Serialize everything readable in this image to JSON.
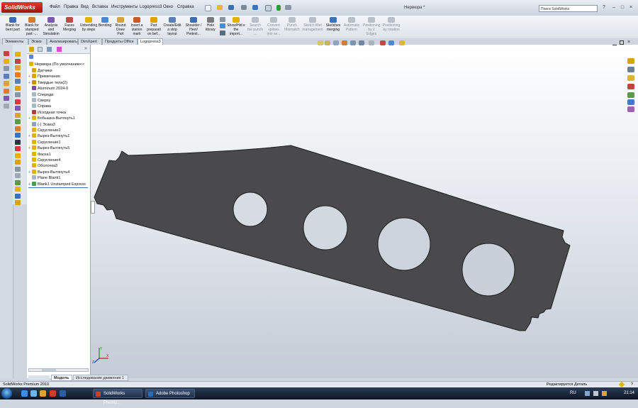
{
  "app": {
    "logo_text": "SolidWorks",
    "doc_title": "Нервюра *",
    "menu": [
      "Файл",
      "Правка",
      "Вид",
      "Вставка",
      "Инструменты",
      "Logopress3",
      "Окно",
      "Справка"
    ],
    "search_placeholder": "Поиск SolidWorks",
    "window_controls": [
      "?",
      "–",
      "□",
      "×"
    ]
  },
  "commands": [
    {
      "label": "Blank for bent part",
      "icon": "blank-icon",
      "enabled": true
    },
    {
      "label": "Blank for stamped part -...",
      "icon": "stamp-icon",
      "enabled": true
    },
    {
      "label": "Analysis and Simulation",
      "icon": "analysis-icon",
      "enabled": true
    },
    {
      "label": "Faces Merging",
      "icon": "merge-icon",
      "enabled": true
    },
    {
      "label": "Unbending by steps",
      "icon": "unbend-icon",
      "enabled": true
    },
    {
      "label": "Bending",
      "icon": "bend-icon",
      "enabled": true
    },
    {
      "label": "Round Draw Part",
      "icon": "draw-icon",
      "enabled": true
    },
    {
      "label": "Insert a station mark",
      "icon": "station-icon",
      "enabled": true
    },
    {
      "label": "Part preparati on bef...",
      "icon": "prep-icon",
      "enabled": true
    },
    {
      "label": "Create/Edit a strip layout",
      "icon": "strip-icon",
      "enabled": true
    },
    {
      "label": "Shoulder / Heel/ Pedest...",
      "icon": "shoulder-icon",
      "enabled": true
    },
    {
      "label": "Hole library",
      "icon": "hole-icon",
      "enabled": true
    },
    {
      "label": "Show/Hid e the import...",
      "icon": "showhide-icon",
      "enabled": true
    },
    {
      "label": "Search the punch ...",
      "icon": "search-punch-icon",
      "enabled": false
    },
    {
      "label": "Convert splines into se...",
      "icon": "convert-icon",
      "enabled": false
    },
    {
      "label": "Punch Mismatch",
      "icon": "mismatch-icon",
      "enabled": false
    },
    {
      "label": "Sketch fillet management",
      "icon": "fillet-icon",
      "enabled": false
    },
    {
      "label": "Sketches merging",
      "icon": "sketch-merge-icon",
      "enabled": true
    },
    {
      "label": "Automatic Pattern",
      "icon": "pattern-icon",
      "enabled": false
    },
    {
      "label": "Positioning by 2 Edges",
      "icon": "pos2-icon",
      "enabled": false
    },
    {
      "label": "Positioning by rotation",
      "icon": "posrot-icon",
      "enabled": false
    }
  ],
  "tabs": [
    {
      "label": "Элементы",
      "active": false
    },
    {
      "label": "Эскиз",
      "active": false
    },
    {
      "label": "Анализировать",
      "active": false
    },
    {
      "label": "DimXpert",
      "active": false
    },
    {
      "label": "Продукты Office",
      "active": false
    },
    {
      "label": "Logopress3",
      "active": true
    }
  ],
  "tree": {
    "root": "Нервюра  (По умолчанию<<",
    "items": [
      {
        "label": "Датчики",
        "icon": "sensor-icon",
        "color": "#d9a400",
        "expand": false
      },
      {
        "label": "Примечания",
        "icon": "annotation-icon",
        "color": "#e0a000",
        "expand": true
      },
      {
        "label": "Твердые тела(2)",
        "icon": "solid-bodies-icon",
        "color": "#d08f00",
        "expand": true
      },
      {
        "label": "Aluminum 2024-0",
        "icon": "material-icon",
        "color": "#7a4b9e",
        "expand": false
      },
      {
        "label": "Спереди",
        "icon": "plane-icon",
        "color": "#a8b6c8",
        "expand": false
      },
      {
        "label": "Сверху",
        "icon": "plane-icon",
        "color": "#a8b6c8",
        "expand": false
      },
      {
        "label": "Справа",
        "icon": "plane-icon",
        "color": "#a8b6c8",
        "expand": false
      },
      {
        "label": "Исходная точка",
        "icon": "origin-icon",
        "color": "#b04040",
        "expand": false
      },
      {
        "label": "Бобышка-Вытянуть1",
        "icon": "extrude-icon",
        "color": "#e1b300",
        "expand": true
      },
      {
        "label": "(-) Эскиз3",
        "icon": "sketch-icon",
        "color": "#8aa0b8",
        "expand": false
      },
      {
        "label": "Скругление2",
        "icon": "fillet-icon",
        "color": "#e1b300",
        "expand": false
      },
      {
        "label": "Вырез-Вытянуть1",
        "icon": "cut-icon",
        "color": "#e1b300",
        "expand": true
      },
      {
        "label": "Скругление1",
        "icon": "fillet-icon",
        "color": "#e1b300",
        "expand": false
      },
      {
        "label": "Вырез-Вытянуть5",
        "icon": "cut-icon",
        "color": "#e1b300",
        "expand": true
      },
      {
        "label": "Фаска1",
        "icon": "chamfer-icon",
        "color": "#e1b300",
        "expand": false
      },
      {
        "label": "Скругление4",
        "icon": "fillet-icon",
        "color": "#e1b300",
        "expand": false
      },
      {
        "label": "Оболочка3",
        "icon": "shell-icon",
        "color": "#e1b300",
        "expand": false
      },
      {
        "label": "Вырез-Вытянуть4",
        "icon": "cut-icon",
        "color": "#e1b300",
        "expand": true
      },
      {
        "label": "Plane Blank1",
        "icon": "plane-icon",
        "color": "#a8b6c8",
        "expand": false
      },
      {
        "label": "Blank1 Unstamped Express",
        "icon": "blank-icon",
        "color": "#4aa04a",
        "expand": true
      }
    ]
  },
  "bottom_tabs": [
    {
      "label": "Модель",
      "active": true
    },
    {
      "label": "Исследование движения 1",
      "active": false
    }
  ],
  "status": {
    "left": "SolidWorks Premium 2010",
    "right": "Редактируется Деталь",
    "help": "?"
  },
  "taskbar": {
    "items": [
      "SolidWorks Premiu...",
      "Adobe Photoshop"
    ],
    "lang": "RU",
    "time": "21:14"
  }
}
